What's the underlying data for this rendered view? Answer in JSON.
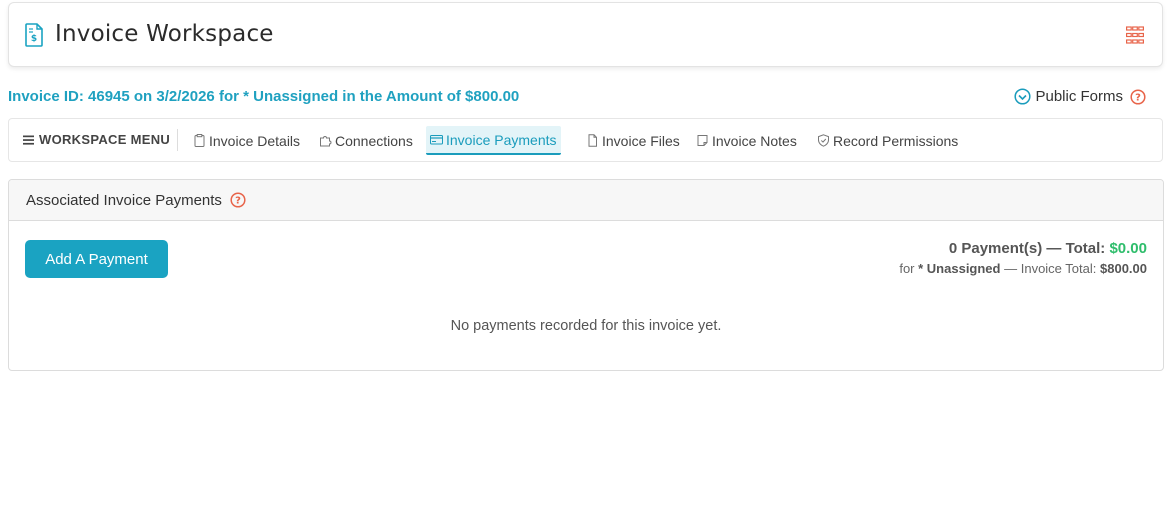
{
  "header": {
    "title": "Invoice Workspace",
    "icon": "invoice-dollar-icon",
    "grid_icon": "grid-menu-icon",
    "accent_color": "#e8644a"
  },
  "invoice_line": "Invoice ID: 46945 on 3/2/2026 for * Unassigned in the Amount of $800.00",
  "public_forms": {
    "label": "Public Forms",
    "icon": "check-circle-icon",
    "help_icon": "help-circle-icon"
  },
  "menu": {
    "label": "WORKSPACE MENU",
    "tabs": [
      {
        "label": "Invoice Details",
        "icon": "clipboard-icon",
        "active": false
      },
      {
        "label": "Connections",
        "icon": "puzzle-icon",
        "active": false
      },
      {
        "label": "Invoice Payments",
        "icon": "credit-card-icon",
        "active": true
      },
      {
        "label": "Invoice Files",
        "icon": "file-icon",
        "active": false
      },
      {
        "label": "Invoice Notes",
        "icon": "note-icon",
        "active": false
      },
      {
        "label": "Record Permissions",
        "icon": "shield-icon",
        "active": false
      }
    ]
  },
  "panel": {
    "title": "Associated Invoice Payments",
    "add_button": "Add A Payment",
    "totals": {
      "count_text": "0 Payment(s) — Total:",
      "total_amount": "$0.00",
      "for_prefix": "for",
      "assignee": "* Unassigned",
      "invoice_total_label": "— Invoice Total:",
      "invoice_total": "$800.00"
    },
    "empty_message": "No payments recorded for this invoice yet."
  },
  "colors": {
    "primary": "#1aa3c2",
    "link": "#1fa1c0",
    "success": "#2ebd6b",
    "danger": "#e8644a"
  }
}
